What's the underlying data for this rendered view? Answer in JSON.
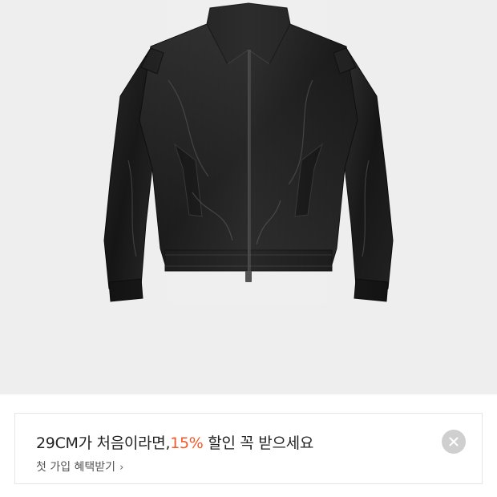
{
  "product": {
    "image_alt": "black leather zip-up jacket"
  },
  "promo": {
    "headline_prefix": "29CM가 처음이라면,",
    "headline_discount": "15%",
    "headline_suffix": " 할인 꼭 받으세요",
    "link_label": "첫 가입 혜택받기",
    "chevron_glyph": "›",
    "highlight_color": "#f05a28"
  },
  "icons": {
    "close": "close-icon",
    "chevron": "chevron-right-icon"
  }
}
